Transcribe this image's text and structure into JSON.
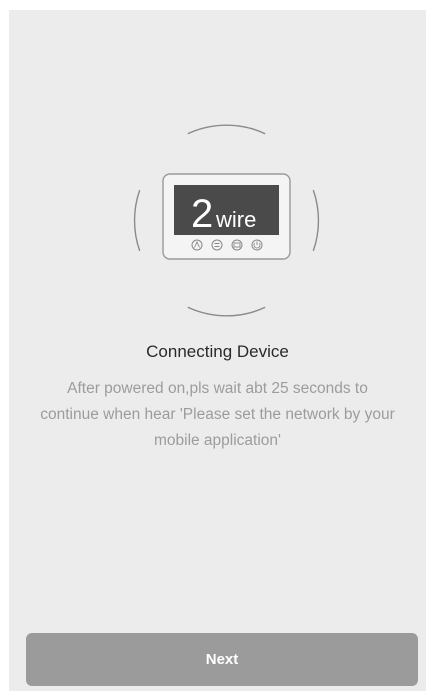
{
  "device": {
    "display_number": "2",
    "display_unit": "wire",
    "button_icons": [
      "auto-icon",
      "fan-icon",
      "mode-icon",
      "power-icon"
    ]
  },
  "content": {
    "title": "Connecting Device",
    "description": "After powered on,pls wait abt 25 seconds to continue when hear 'Please set the network by your mobile application'"
  },
  "actions": {
    "next_label": "Next"
  },
  "colors": {
    "background": "#ececec",
    "button": "#9b9b9b",
    "title_text": "#2a2a2a",
    "description_text": "#9c9c9c",
    "display_screen": "#4a4a4a"
  }
}
